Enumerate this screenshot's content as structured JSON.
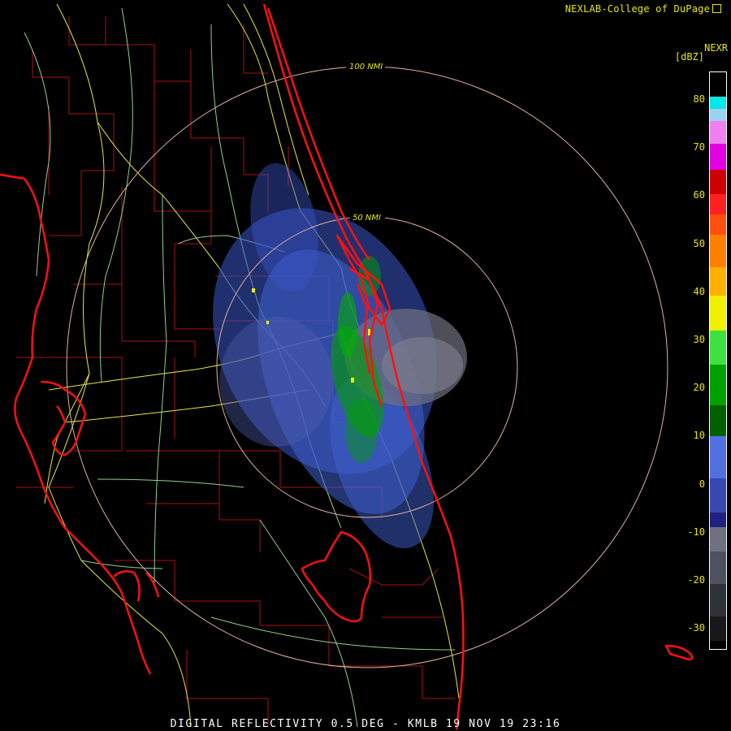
{
  "header": {
    "credit": "NEXLAB-College of DuPage",
    "product": "NEXR",
    "units": "[dBZ]"
  },
  "footer": {
    "caption": "DIGITAL REFLECTIVITY 0.5 DEG - KMLB 19 NOV 19 23:16"
  },
  "range_rings": [
    {
      "label": "100 NMI"
    },
    {
      "label": "50 NMI"
    }
  ],
  "colorbar": {
    "ticks": [
      "80",
      "70",
      "60",
      "50",
      "40",
      "30",
      "20",
      "10",
      "0",
      "-10",
      "-20",
      "-30"
    ],
    "colors": {
      "cyan": "#00e8e8",
      "magenta_light": "#f080f0",
      "magenta": "#e000e0",
      "red_dark": "#d00000",
      "red": "#ff2020",
      "orange": "#ff8000",
      "yellow": "#f0f000",
      "green_light": "#40e040",
      "green": "#00a000",
      "green_dark": "#006000",
      "blue_light": "#5070e0",
      "blue_dark": "#202080",
      "gray": "#707080",
      "gray_dark": "#303038",
      "black": "#000000"
    }
  },
  "map_colors": {
    "coastline": "#ff1010",
    "county_lines": "#b01010",
    "roads_yellow": "#e8e840",
    "roads_green": "#90d090",
    "ring": "#e0b0a0"
  }
}
